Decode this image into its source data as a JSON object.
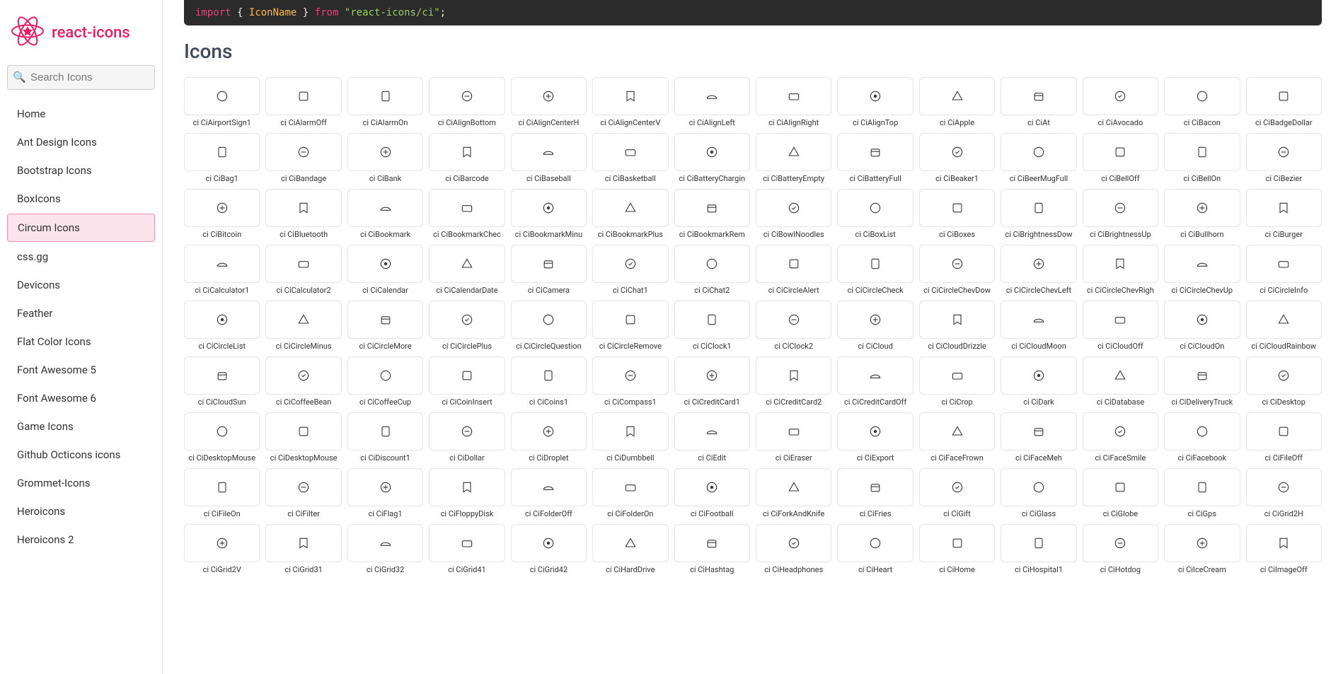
{
  "brand": {
    "name": "react-icons"
  },
  "search": {
    "placeholder": "Search Icons"
  },
  "nav": {
    "items": [
      {
        "label": "Home",
        "active": false
      },
      {
        "label": "Ant Design Icons",
        "active": false
      },
      {
        "label": "Bootstrap Icons",
        "active": false
      },
      {
        "label": "BoxIcons",
        "active": false
      },
      {
        "label": "Circum Icons",
        "active": true
      },
      {
        "label": "css.gg",
        "active": false
      },
      {
        "label": "Devicons",
        "active": false
      },
      {
        "label": "Feather",
        "active": false
      },
      {
        "label": "Flat Color Icons",
        "active": false
      },
      {
        "label": "Font Awesome 5",
        "active": false
      },
      {
        "label": "Font Awesome 6",
        "active": false
      },
      {
        "label": "Game Icons",
        "active": false
      },
      {
        "label": "Github Octicons icons",
        "active": false
      },
      {
        "label": "Grommet-Icons",
        "active": false
      },
      {
        "label": "Heroicons",
        "active": false
      },
      {
        "label": "Heroicons 2",
        "active": false
      }
    ]
  },
  "code": {
    "import": "import",
    "lbrace": "{",
    "iconname": "IconName",
    "rbrace": "}",
    "from": "from",
    "package": "\"react-icons/ci\"",
    "semi": ";"
  },
  "section_title": "Icons",
  "icons": [
    "ci CiAirportSign1",
    "ci CiAlarmOff",
    "ci CiAlarmOn",
    "ci CiAlignBottom",
    "ci CiAlignCenterH",
    "ci CiAlignCenterV",
    "ci CiAlignLeft",
    "ci CiAlignRight",
    "ci CiAlignTop",
    "ci CiApple",
    "ci CiAt",
    "ci CiAvocado",
    "ci CiBacon",
    "ci CiBadgeDollar",
    "ci CiBag1",
    "ci CiBandage",
    "ci CiBank",
    "ci CiBarcode",
    "ci CiBaseball",
    "ci CiBasketball",
    "ci CiBatteryChargin",
    "ci CiBatteryEmpty",
    "ci CiBatteryFull",
    "ci CiBeaker1",
    "ci CiBeerMugFull",
    "ci CiBellOff",
    "ci CiBellOn",
    "ci CiBezier",
    "ci CiBitcoin",
    "ci CiBluetooth",
    "ci CiBookmark",
    "ci CiBookmarkChec",
    "ci CiBookmarkMinu",
    "ci CiBookmarkPlus",
    "ci CiBookmarkRem",
    "ci CiBowlNoodles",
    "ci CiBoxList",
    "ci CiBoxes",
    "ci CiBrightnessDow",
    "ci CiBrightnessUp",
    "ci CiBullhorn",
    "ci CiBurger",
    "ci CiCalculator1",
    "ci CiCalculator2",
    "ci CiCalendar",
    "ci CiCalendarDate",
    "ci CiCamera",
    "ci CiChat1",
    "ci CiChat2",
    "ci CiCircleAlert",
    "ci CiCircleCheck",
    "ci CiCircleChevDow",
    "ci CiCircleChevLeft",
    "ci CiCircleChevRigh",
    "ci CiCircleChevUp",
    "ci CiCircleInfo",
    "ci CiCircleList",
    "ci CiCircleMinus",
    "ci CiCircleMore",
    "ci CiCirclePlus",
    "ci CiCircleQuestion",
    "ci CiCircleRemove",
    "ci CiClock1",
    "ci CiClock2",
    "ci CiCloud",
    "ci CiCloudDrizzle",
    "ci CiCloudMoon",
    "ci CiCloudOff",
    "ci CiCloudOn",
    "ci CiCloudRainbow",
    "ci CiCloudSun",
    "ci CiCoffeeBean",
    "ci CiCoffeeCup",
    "ci CiCoinInsert",
    "ci CiCoins1",
    "ci CiCompass1",
    "ci CiCreditCard1",
    "ci CiCreditCard2",
    "ci CiCreditCardOff",
    "ci CiCrop",
    "ci CiDark",
    "ci CiDatabase",
    "ci CiDeliveryTruck",
    "ci CiDesktop",
    "ci CiDesktopMouse",
    "ci CiDesktopMouse",
    "ci CiDiscount1",
    "ci CiDollar",
    "ci CiDroplet",
    "ci CiDumbbell",
    "ci CiEdit",
    "ci CiEraser",
    "ci CiExport",
    "ci CiFaceFrown",
    "ci CiFaceMeh",
    "ci CiFaceSmile",
    "ci CiFacebook",
    "ci CiFileOff",
    "ci CiFileOn",
    "ci CiFilter",
    "ci CiFlag1",
    "ci CiFloppyDisk",
    "ci CiFolderOff",
    "ci CiFolderOn",
    "ci CiFootball",
    "ci CiForkAndKnife",
    "ci CiFries",
    "ci CiGift",
    "ci CiGlass",
    "ci CiGlobe",
    "ci CiGps",
    "ci CiGrid2H",
    "ci CiGrid2V",
    "ci CiGrid31",
    "ci CiGrid32",
    "ci CiGrid41",
    "ci CiGrid42",
    "ci CiHardDrive",
    "ci CiHashtag",
    "ci CiHeadphones",
    "ci CiHeart",
    "ci CiHome",
    "ci CiHospital1",
    "ci CiHotdog",
    "ci CiIceCream",
    "ci CiImageOff"
  ]
}
